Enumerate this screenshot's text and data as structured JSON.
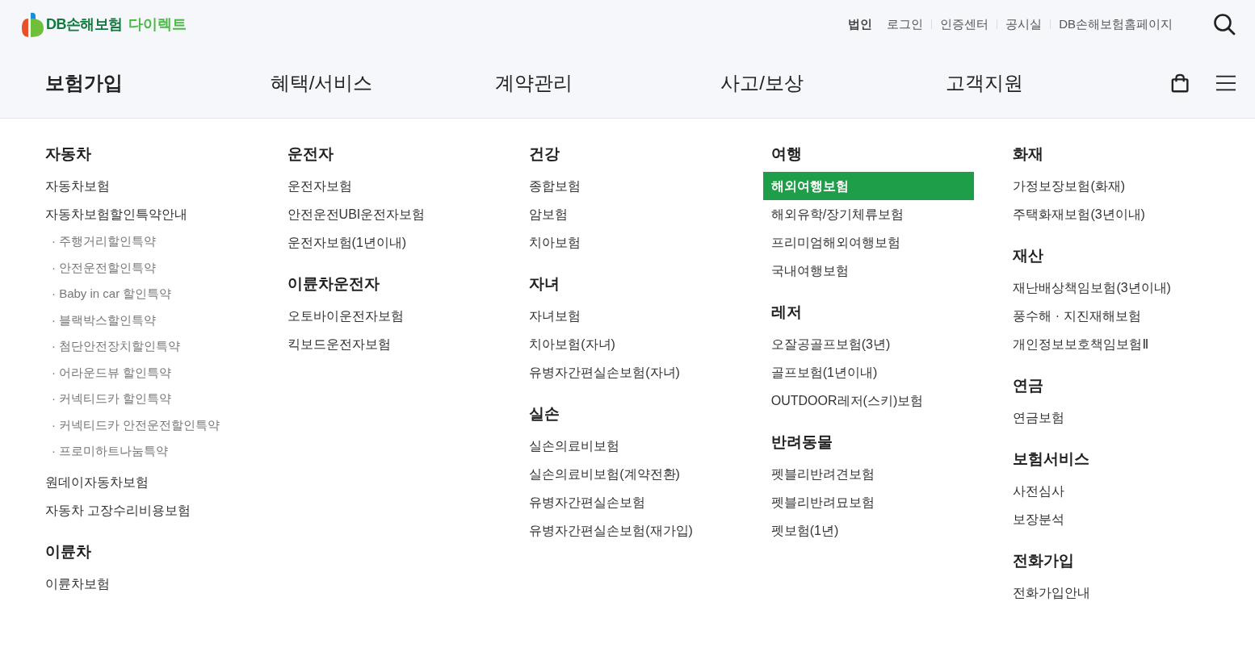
{
  "logo": {
    "brand": "DB손해보험",
    "product": "다이렉트"
  },
  "utility_links": [
    {
      "label": "법인",
      "selected": true
    },
    {
      "label": "로그인",
      "selected": false
    },
    {
      "label": "인증센터",
      "selected": false
    },
    {
      "label": "공시실",
      "selected": false
    },
    {
      "label": "DB손해보험홈페이지",
      "selected": false
    }
  ],
  "main_nav": [
    {
      "label": "보험가입",
      "selected": true
    },
    {
      "label": "혜택/서비스",
      "selected": false
    },
    {
      "label": "계약관리",
      "selected": false
    },
    {
      "label": "사고/보상",
      "selected": false
    },
    {
      "label": "고객지원",
      "selected": false
    }
  ],
  "menu_columns": [
    {
      "groups": [
        {
          "title": "자동차",
          "items": [
            {
              "label": "자동차보험",
              "selected": false
            },
            {
              "label": "자동차보험할인특약안내",
              "selected": false,
              "children": [
                {
                  "label": "· 주행거리할인특약"
                },
                {
                  "label": "· 안전운전할인특약"
                },
                {
                  "label": "· Baby in car 할인특약"
                },
                {
                  "label": "· 블랙박스할인특약"
                },
                {
                  "label": "· 첨단안전장치할인특약"
                },
                {
                  "label": "· 어라운드뷰 할인특약"
                },
                {
                  "label": "· 커넥티드카 할인특약"
                },
                {
                  "label": "· 커넥티드카 안전운전할인특약"
                },
                {
                  "label": "· 프로미하트나눔특약"
                }
              ]
            },
            {
              "label": "원데이자동차보험",
              "selected": false
            },
            {
              "label": "자동차 고장수리비용보험",
              "selected": false
            }
          ]
        },
        {
          "title": "이륜차",
          "items": [
            {
              "label": "이륜차보험",
              "selected": false
            }
          ]
        }
      ]
    },
    {
      "groups": [
        {
          "title": "운전자",
          "items": [
            {
              "label": "운전자보험",
              "selected": false
            },
            {
              "label": "안전운전UBI운전자보험",
              "selected": false
            },
            {
              "label": "운전자보험(1년이내)",
              "selected": false
            }
          ]
        },
        {
          "title": "이륜차운전자",
          "items": [
            {
              "label": "오토바이운전자보험",
              "selected": false
            },
            {
              "label": "킥보드운전자보험",
              "selected": false
            }
          ]
        }
      ]
    },
    {
      "groups": [
        {
          "title": "건강",
          "items": [
            {
              "label": "종합보험",
              "selected": false
            },
            {
              "label": "암보험",
              "selected": false
            },
            {
              "label": "치아보험",
              "selected": false
            }
          ]
        },
        {
          "title": "자녀",
          "items": [
            {
              "label": "자녀보험",
              "selected": false
            },
            {
              "label": "치아보험(자녀)",
              "selected": false
            },
            {
              "label": "유병자간편실손보험(자녀)",
              "selected": false
            }
          ]
        },
        {
          "title": "실손",
          "items": [
            {
              "label": "실손의료비보험",
              "selected": false
            },
            {
              "label": "실손의료비보험(계약전환)",
              "selected": false
            },
            {
              "label": "유병자간편실손보험",
              "selected": false
            },
            {
              "label": "유병자간편실손보험(재가입)",
              "selected": false
            }
          ]
        }
      ]
    },
    {
      "groups": [
        {
          "title": "여행",
          "items": [
            {
              "label": "해외여행보험",
              "selected": true
            },
            {
              "label": "해외유학/장기체류보험",
              "selected": false
            },
            {
              "label": "프리미엄해외여행보험",
              "selected": false
            },
            {
              "label": "국내여행보험",
              "selected": false
            }
          ]
        },
        {
          "title": "레저",
          "items": [
            {
              "label": "오잘공골프보험(3년)",
              "selected": false
            },
            {
              "label": "골프보험(1년이내)",
              "selected": false
            },
            {
              "label": "OUTDOOR레저(스키)보험",
              "selected": false
            }
          ]
        },
        {
          "title": "반려동물",
          "items": [
            {
              "label": "펫블리반려견보험",
              "selected": false
            },
            {
              "label": "펫블리반려묘보험",
              "selected": false
            },
            {
              "label": "펫보험(1년)",
              "selected": false
            }
          ]
        }
      ]
    },
    {
      "groups": [
        {
          "title": "화재",
          "items": [
            {
              "label": "가정보장보험(화재)",
              "selected": false
            },
            {
              "label": "주택화재보험(3년이내)",
              "selected": false
            }
          ]
        },
        {
          "title": "재산",
          "items": [
            {
              "label": "재난배상책임보험(3년이내)",
              "selected": false
            },
            {
              "label": "풍수해 · 지진재해보험",
              "selected": false
            },
            {
              "label": "개인정보보호책임보험Ⅱ",
              "selected": false
            }
          ]
        },
        {
          "title": "연금",
          "items": [
            {
              "label": "연금보험",
              "selected": false
            }
          ]
        },
        {
          "title": "보험서비스",
          "items": [
            {
              "label": "사전심사",
              "selected": false
            },
            {
              "label": "보장분석",
              "selected": false
            }
          ]
        },
        {
          "title": "전화가입",
          "items": [
            {
              "label": "전화가입안내",
              "selected": false
            }
          ]
        }
      ]
    }
  ]
}
